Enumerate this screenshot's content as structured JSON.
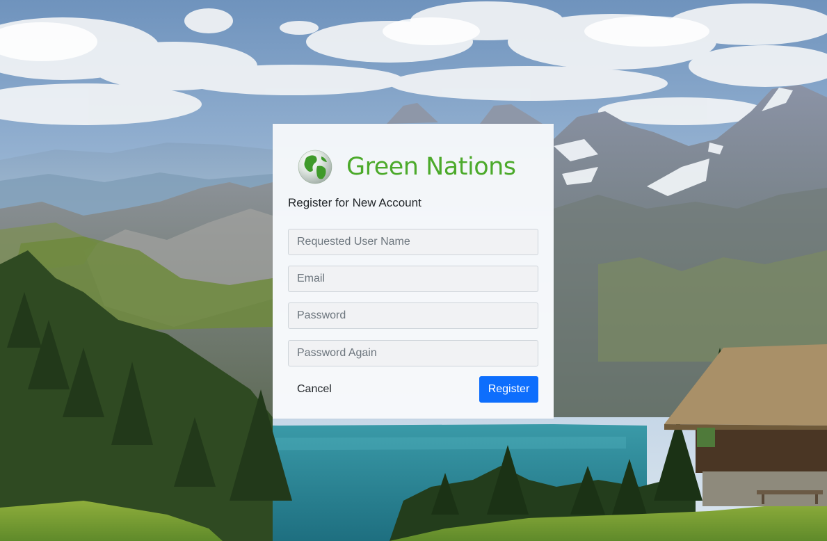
{
  "brand": {
    "name": "Green Nations",
    "name_color": "#4caa2b",
    "logo_icon": "globe-icon"
  },
  "form": {
    "title": "Register for New Account",
    "fields": {
      "username": {
        "value": "",
        "placeholder": "Requested User Name"
      },
      "email": {
        "value": "",
        "placeholder": "Email"
      },
      "password": {
        "value": "",
        "placeholder": "Password"
      },
      "password_again": {
        "value": "",
        "placeholder": "Password Again"
      }
    },
    "cancel_label": "Cancel",
    "register_label": "Register"
  },
  "colors": {
    "primary_button": "#0d6efd",
    "card_background": "#fafbfc"
  }
}
